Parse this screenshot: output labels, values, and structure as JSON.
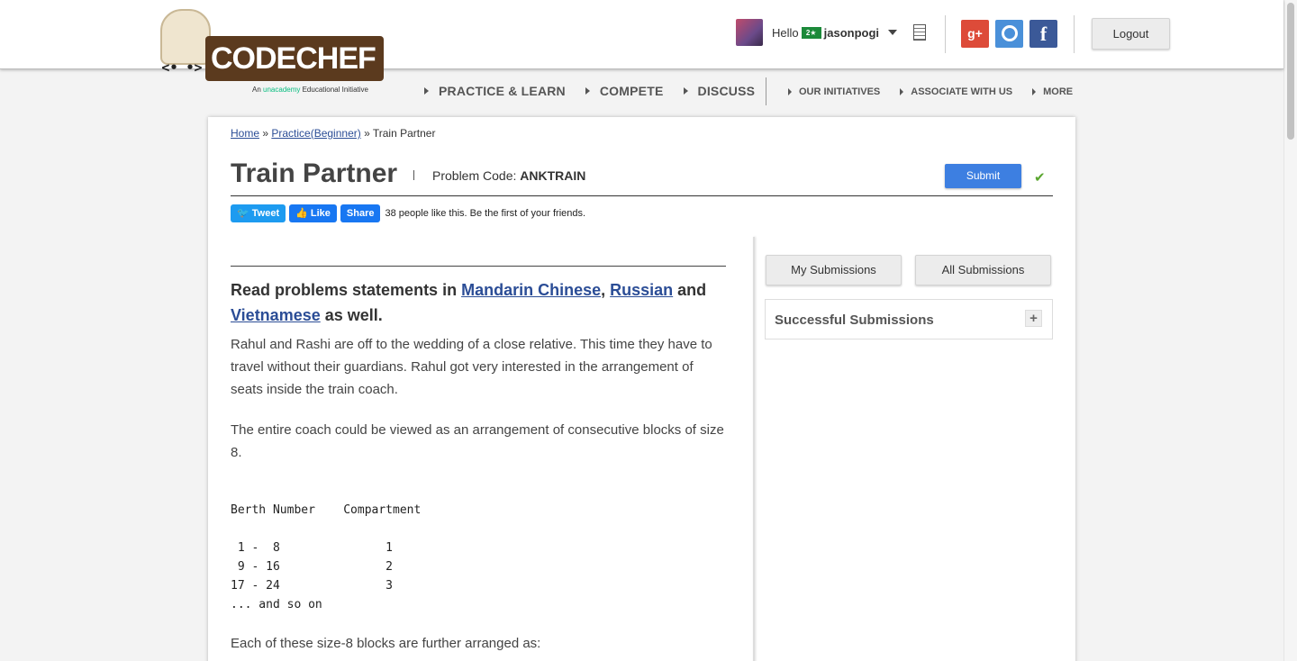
{
  "logo": {
    "text": "CODECHEF",
    "tagline_prefix": "An ",
    "tagline_brand": "unacademy",
    "tagline_suffix": " Educational Initiative"
  },
  "user": {
    "greeting": "Hello",
    "flag": "2★",
    "username": "jasonpogi"
  },
  "header": {
    "logout_label": "Logout",
    "social": [
      "google-plus",
      "github",
      "facebook"
    ]
  },
  "nav": {
    "main": [
      "PRACTICE & LEARN",
      "COMPETE",
      "DISCUSS"
    ],
    "secondary": [
      "OUR INITIATIVES",
      "ASSOCIATE WITH US",
      "MORE"
    ]
  },
  "breadcrumb": {
    "home": "Home",
    "sep1": " » ",
    "practice": "Practice(Beginner)",
    "sep2": " » ",
    "current": "Train Partner"
  },
  "problem": {
    "title": "Train Partner",
    "code_label": "Problem Code: ",
    "code": "ANKTRAIN",
    "submit_label": "Submit",
    "solved_mark": "✔"
  },
  "share": {
    "tweet": "Tweet",
    "like": "Like",
    "share": "Share",
    "like_text": "38 people like this. Be the first of your friends."
  },
  "languages": {
    "prefix": "Read problems statements in ",
    "lang1": "Mandarin Chinese",
    "comma": ",",
    "lang2": "Russian",
    "and": " and",
    "lang3": "Vietnamese",
    "suffix": " as well."
  },
  "statement": {
    "p1": "Rahul and Rashi are off to the wedding of a close relative. This time they have to travel without their guardians. Rahul got very interested in the arrangement of seats inside the train coach.",
    "p2": "The entire coach could be viewed as an arrangement of consecutive blocks of size 8.",
    "table": "Berth Number    Compartment\n\n 1 -  8               1\n 9 - 16               2\n17 - 24               3\n... and so on",
    "p3": "Each of these size-8 blocks are further arranged as:"
  },
  "sidebar": {
    "my_submissions": "My Submissions",
    "all_submissions": "All Submissions",
    "successful_submissions": "Successful Submissions",
    "expand": "+"
  },
  "colors": {
    "brand_brown": "#5b3a1e",
    "submit_blue": "#3d7fe1",
    "link_blue": "#2b4d96",
    "check_green": "#5aa62f"
  }
}
